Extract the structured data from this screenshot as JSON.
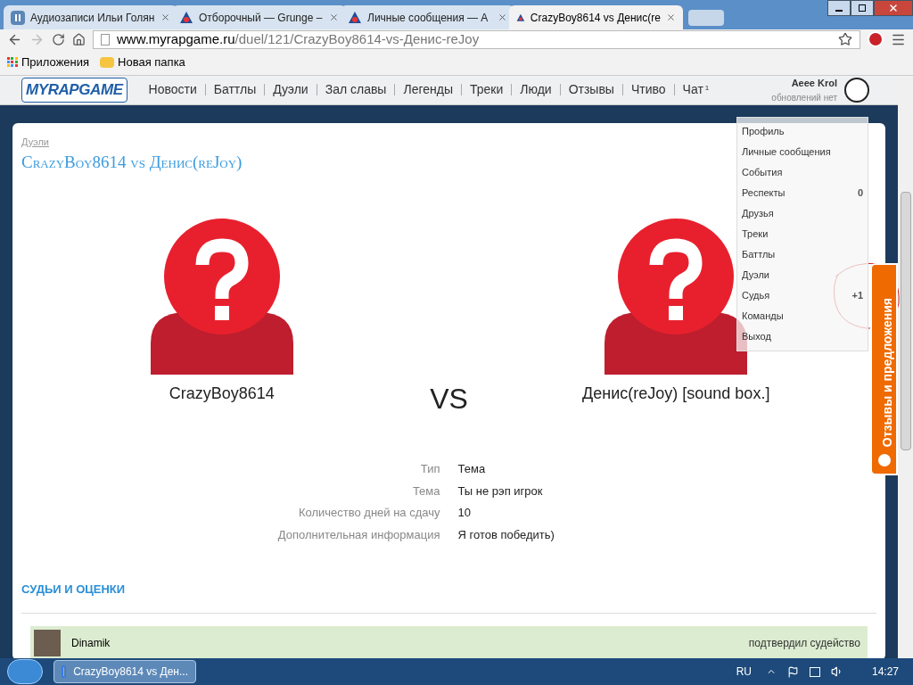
{
  "browser": {
    "tabs": [
      {
        "title": "Аудиозаписи Ильи Голян",
        "selected": false,
        "kind": "pause"
      },
      {
        "title": "Отборочный — Grunge –",
        "selected": false,
        "kind": "site"
      },
      {
        "title": "Личные сообщения — А",
        "selected": false,
        "kind": "site"
      },
      {
        "title": "CrazyBoy8614 vs Денис(re",
        "selected": true,
        "kind": "site"
      }
    ],
    "url_host": "www.myrapgame.ru",
    "url_path": "/duel/121/CrazyBoy8614-vs-Денис-reJoy",
    "bookmarks": [
      {
        "label": "Приложения",
        "kind": "apps"
      },
      {
        "label": "Новая папка",
        "kind": "folder"
      }
    ]
  },
  "site": {
    "logo": "MYRAPGAME",
    "nav": [
      {
        "label": "Новости"
      },
      {
        "label": "Баттлы"
      },
      {
        "label": "Дуэли"
      },
      {
        "label": "Зал славы"
      },
      {
        "label": "Легенды"
      },
      {
        "label": "Треки"
      },
      {
        "label": "Люди"
      },
      {
        "label": "Отзывы"
      },
      {
        "label": "Чтиво"
      },
      {
        "label": "Чат",
        "badge": "1"
      }
    ],
    "user": {
      "name": "Aeee Krol",
      "status": "обновлений нет"
    },
    "user_menu": [
      {
        "label": "Профиль"
      },
      {
        "label": "Личные сообщения"
      },
      {
        "label": "События"
      },
      {
        "label": "Респекты",
        "count": "0"
      },
      {
        "label": "Друзья"
      },
      {
        "label": "Треки"
      },
      {
        "label": "Баттлы"
      },
      {
        "label": "Дуэли"
      },
      {
        "label": "Судья",
        "count": "+1"
      },
      {
        "label": "Команды"
      },
      {
        "label": "Выход"
      }
    ]
  },
  "duel": {
    "breadcrumb": "Дуэли",
    "title": "CrazyBoy8614 vs Денис(reJoy)",
    "players": [
      {
        "name": "CrazyBoy8614"
      },
      {
        "name": "Денис(reJoy) [sound box.]"
      }
    ],
    "versus": "VS",
    "details": [
      {
        "label": "Тип",
        "value": "Тема"
      },
      {
        "label": "Тема",
        "value": "Ты не рэп игрок"
      },
      {
        "label": "Количество дней на сдачу",
        "value": "10"
      },
      {
        "label": "Дополнительная информация",
        "value": "Я готов победить)"
      }
    ],
    "judges_heading": "СУДЬИ И ОЦЕНКИ",
    "judges": [
      {
        "name": "Dinamik",
        "status": "подтвердил судейство"
      }
    ]
  },
  "feedback_tab": "Отзывы и предложения",
  "taskbar": {
    "task": "CrazyBoy8614 vs Ден...",
    "language": "RU",
    "time": "14:27"
  }
}
